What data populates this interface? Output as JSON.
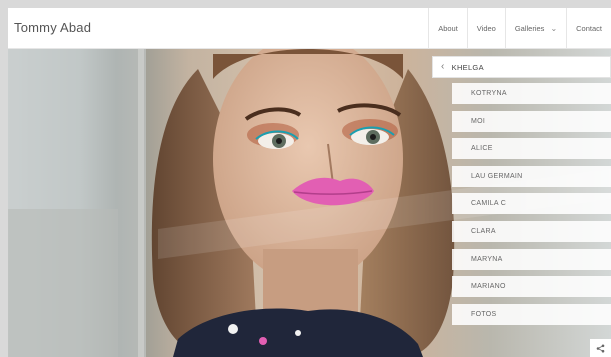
{
  "brand": "Tommy Abad",
  "nav": {
    "about": "About",
    "video": "Video",
    "galleries": "Galleries",
    "contact": "Contact"
  },
  "menu": {
    "current": "KHELGA",
    "items": [
      "KOTRYNA",
      "MOI",
      "ALICE",
      "LAU GERMAIN",
      "CAMILA C",
      "CLARA",
      "MARYNA",
      "MARIANO",
      "FOTOS"
    ]
  },
  "icons": {
    "galleries_chevron": "chevron-down-icon",
    "back": "chevron-left-icon",
    "share": "share-icon"
  },
  "colors": {
    "background": "#d9d9d9",
    "header": "#ffffff",
    "text": "#555555",
    "lips": "#e25fb3"
  }
}
